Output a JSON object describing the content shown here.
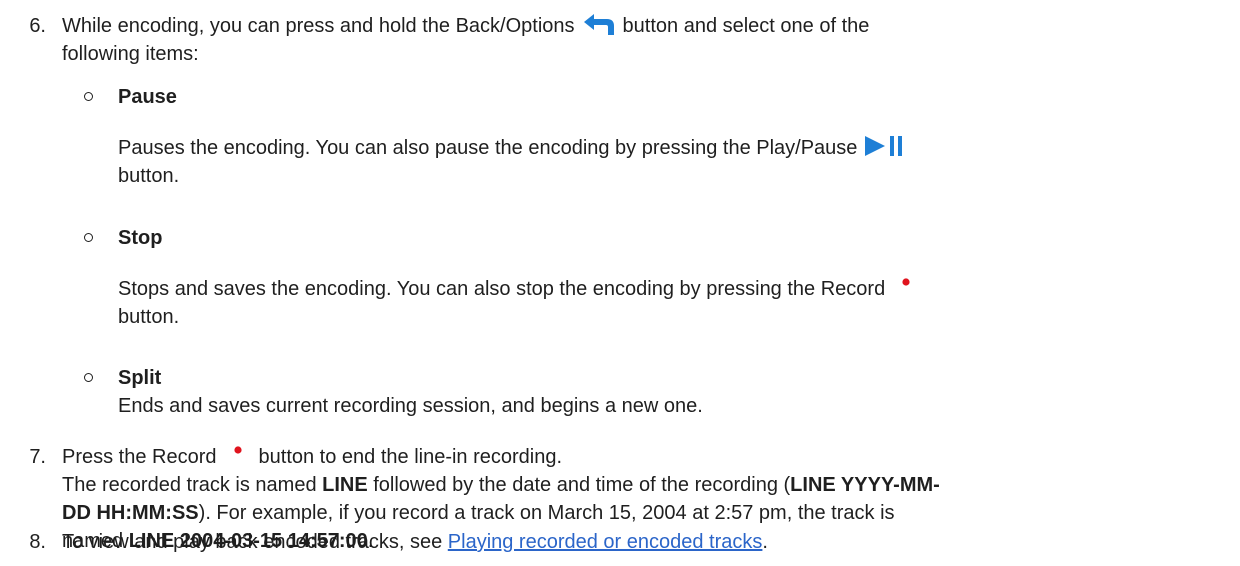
{
  "steps": [
    {
      "number": "6.",
      "text_before_icon": "While encoding, you can press and hold the Back/Options",
      "icon": "back-arrow-icon",
      "text_after_icon": "button and select one of the",
      "text_line2": "following items:",
      "items": [
        {
          "title": "Pause",
          "desc_before_icon": "Pauses the encoding. You can also pause the encoding by pressing the Play/Pause",
          "icon": "play-pause-icon",
          "desc_after_icon": "button."
        },
        {
          "title": "Stop",
          "desc_before_icon": "Stops and saves the encoding. You can also stop the encoding by pressing the Record",
          "icon": "record-icon",
          "desc_after_icon": "button."
        },
        {
          "title": "Split",
          "desc": "Ends and saves current recording session, and begins a new one."
        }
      ]
    },
    {
      "number": "7.",
      "line1_before_icon": "Press the Record",
      "icon": "record-icon",
      "line1_after_icon": "button to end the line-in recording.",
      "line2_a": "The recorded track is named ",
      "line2_b": "LINE",
      "line2_c": " followed by the date and time of the recording (",
      "line2_d": "LINE YYYY-MM-",
      "line3_a": "DD HH:MM:SS",
      "line3_b": "). For example, if you record a track on March 15, 2004 at 2:57 pm, the track is",
      "line4_a": "named ",
      "line4_b": "LINE 2004-03-15 14:57:00",
      "line4_c": "."
    },
    {
      "number": "8.",
      "text_before_link": "To view and play back encoded tracks, see ",
      "link_text": "Playing recorded or encoded tracks",
      "text_after_link": "."
    }
  ],
  "colors": {
    "text": "#1f1f1f",
    "link": "#2b65c9",
    "back_icon": "#1e7fd6",
    "play_icon": "#1e7fd6",
    "record_icon": "#e0141e"
  }
}
